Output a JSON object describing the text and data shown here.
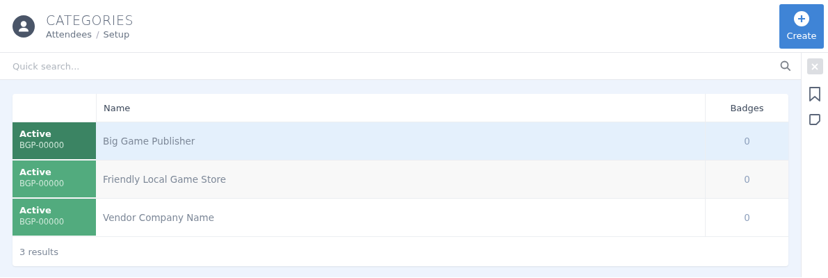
{
  "header": {
    "title": "CATEGORIES",
    "breadcrumbs": [
      "Attendees",
      "Setup"
    ],
    "breadcrumb_separator": "/",
    "create_button": "Create"
  },
  "search": {
    "placeholder": "Quick search..."
  },
  "table": {
    "columns": [
      "Name",
      "Badges"
    ],
    "rows": [
      {
        "status": "Active",
        "code": "BGP-00000",
        "name": "Big Game Publisher",
        "badges": "0",
        "selected": true
      },
      {
        "status": "Active",
        "code": "BGP-00000",
        "name": "Friendly Local Game Store",
        "badges": "0",
        "selected": false
      },
      {
        "status": "Active",
        "code": "BGP-00000",
        "name": "Vendor Company Name",
        "badges": "0",
        "selected": false
      }
    ],
    "footer": "3 results"
  }
}
